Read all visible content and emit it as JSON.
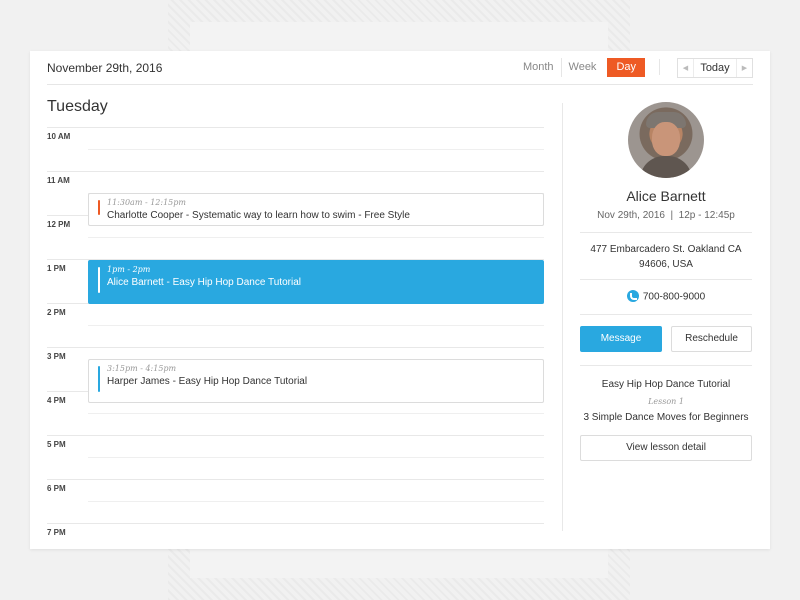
{
  "header": {
    "date": "November 29th, 2016",
    "views": [
      "Month",
      "Week",
      "Day"
    ],
    "active_view": "Day",
    "today_label": "Today",
    "prev_icon": "chevron-left-icon",
    "next_icon": "chevron-right-icon"
  },
  "day": {
    "title": "Tuesday",
    "hours": [
      "10 AM",
      "11 AM",
      "12 PM",
      "1 PM",
      "2 PM",
      "3 PM",
      "4 PM",
      "5 PM",
      "6 PM",
      "7 PM"
    ]
  },
  "events": [
    {
      "time": "11:30am - 12:15pm",
      "title": "Charlotte Cooper - Systematic way to learn how to swim - Free Style",
      "color": "#ee5a24",
      "active": false
    },
    {
      "time": "1pm - 2pm",
      "title": "Alice Barnett - Easy Hip Hop Dance Tutorial",
      "color": "#ffffff",
      "active": true
    },
    {
      "time": "3:15pm - 4:15pm",
      "title": "Harper James - Easy Hip Hop Dance Tutorial",
      "color": "#29a8e0",
      "active": false
    }
  ],
  "panel": {
    "name": "Alice Barnett",
    "when": "Nov 29th, 2016  |  12p - 12:45p",
    "address_line1": "477 Embarcadero St. Oakland CA",
    "address_line2": "94606, USA",
    "phone": "700-800-9000",
    "message_label": "Message",
    "reschedule_label": "Reschedule",
    "course": "Easy Hip Hop Dance Tutorial",
    "lesson": "Lesson 1",
    "lesson_title": "3 Simple Dance Moves for Beginners",
    "lesson_button": "View lesson detail"
  },
  "colors": {
    "accent": "#ee5a24",
    "primary": "#29a8e0"
  }
}
